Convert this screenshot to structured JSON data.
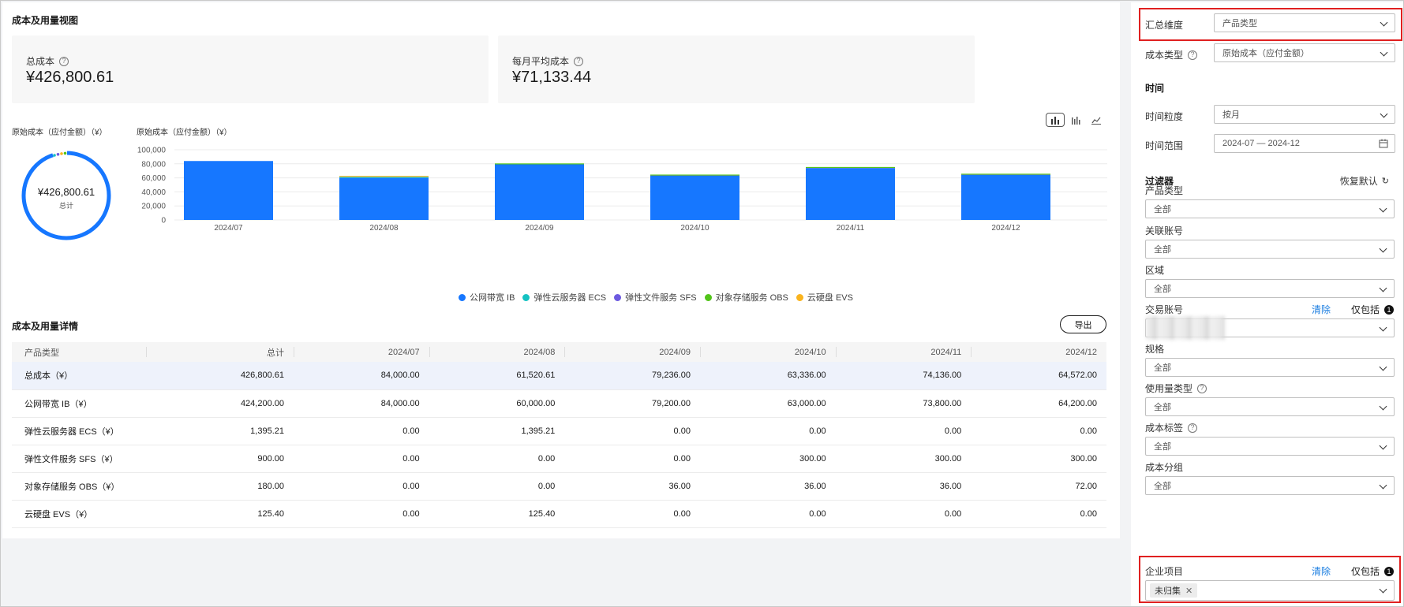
{
  "overview_title": "成本及用量视图",
  "total_cost": {
    "label": "总成本",
    "value": "¥426,800.61"
  },
  "monthly_avg": {
    "label": "每月平均成本",
    "value": "¥71,133.44"
  },
  "donut": {
    "title": "原始成本（应付金额）（¥）",
    "center_value": "¥426,800.61",
    "center_label": "总计"
  },
  "colors": {
    "ib": "#1677ff",
    "ecs": "#15c2c2",
    "sfs": "#6d5ae0",
    "obs": "#52c41a",
    "evs": "#fab41e"
  },
  "chart_data": {
    "type": "bar",
    "title": "原始成本（应付金额）（¥）",
    "categories": [
      "2024/07",
      "2024/08",
      "2024/09",
      "2024/10",
      "2024/11",
      "2024/12"
    ],
    "series": [
      {
        "name": "公网带宽 IB",
        "values": [
          84000,
          60000,
          79200,
          63000,
          73800,
          64200
        ]
      },
      {
        "name": "弹性云服务器 ECS",
        "values": [
          0,
          1395.21,
          0,
          0,
          0,
          0
        ]
      },
      {
        "name": "弹性文件服务 SFS",
        "values": [
          0,
          0,
          0,
          300,
          300,
          300
        ]
      },
      {
        "name": "对象存储服务 OBS",
        "values": [
          0,
          0,
          36,
          36,
          36,
          72
        ]
      },
      {
        "name": "云硬盘 EVS",
        "values": [
          0,
          125.4,
          0,
          0,
          0,
          0
        ]
      }
    ],
    "yticks": [
      "100,000",
      "80,000",
      "60,000",
      "40,000",
      "20,000",
      "0"
    ],
    "ylim": [
      0,
      100000
    ],
    "stacked": true,
    "grid": true,
    "legend": "bottom"
  },
  "details_title": "成本及用量详情",
  "export_label": "导出",
  "table": {
    "headers": [
      "产品类型",
      "总计",
      "2024/07",
      "2024/08",
      "2024/09",
      "2024/10",
      "2024/11",
      "2024/12"
    ],
    "rows": [
      [
        "总成本（¥）",
        "426,800.61",
        "84,000.00",
        "61,520.61",
        "79,236.00",
        "63,336.00",
        "74,136.00",
        "64,572.00"
      ],
      [
        "公网带宽 IB（¥）",
        "424,200.00",
        "84,000.00",
        "60,000.00",
        "79,200.00",
        "63,000.00",
        "73,800.00",
        "64,200.00"
      ],
      [
        "弹性云服务器 ECS（¥）",
        "1,395.21",
        "0.00",
        "1,395.21",
        "0.00",
        "0.00",
        "0.00",
        "0.00"
      ],
      [
        "弹性文件服务 SFS（¥）",
        "900.00",
        "0.00",
        "0.00",
        "0.00",
        "300.00",
        "300.00",
        "300.00"
      ],
      [
        "对象存储服务 OBS（¥）",
        "180.00",
        "0.00",
        "0.00",
        "36.00",
        "36.00",
        "36.00",
        "72.00"
      ],
      [
        "云硬盘 EVS（¥）",
        "125.40",
        "0.00",
        "125.40",
        "0.00",
        "0.00",
        "0.00",
        "0.00"
      ]
    ]
  },
  "panel": {
    "summary_dim": {
      "label": "汇总维度",
      "value": "产品类型"
    },
    "cost_type": {
      "label": "成本类型",
      "value": "原始成本（应付金额）"
    },
    "time_section": "时间",
    "granularity": {
      "label": "时间粒度",
      "value": "按月"
    },
    "range": {
      "label": "时间范围",
      "value": "2024-07 — 2024-12"
    },
    "filter_section": "过滤器",
    "reset": "恢复默认",
    "clear": "清除",
    "only_include": "仅包括",
    "only_count": "1",
    "all": "全部",
    "filters": [
      "产品类型",
      "关联账号",
      "区域",
      "交易账号",
      "规格",
      "使用量类型",
      "成本标签",
      "成本分组"
    ],
    "enterprise": {
      "label": "企业项目",
      "tag": "未归集"
    }
  }
}
